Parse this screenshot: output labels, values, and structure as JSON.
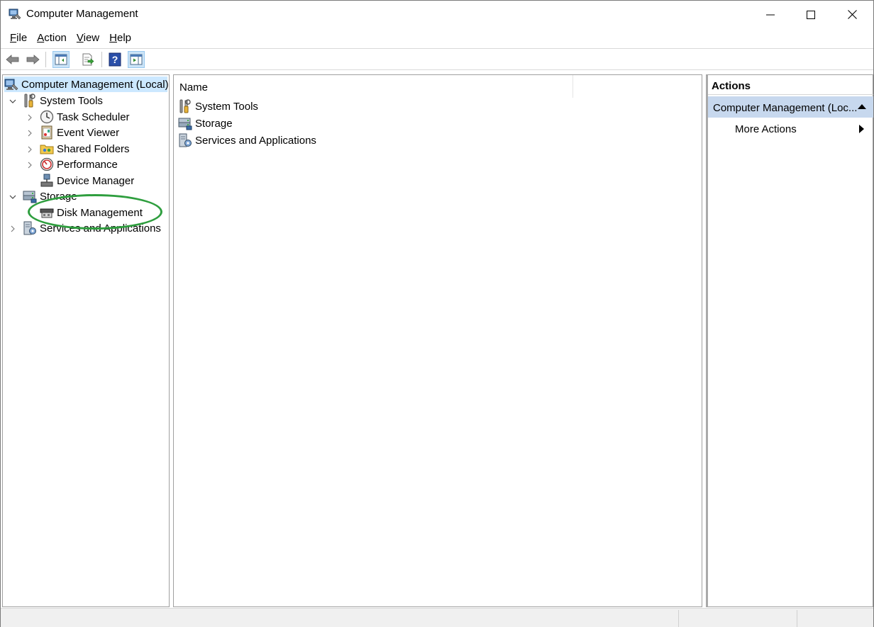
{
  "window": {
    "title": "Computer Management"
  },
  "menu": [
    {
      "label": "File",
      "key": "F",
      "rest": "ile"
    },
    {
      "label": "Action",
      "key": "A",
      "rest": "ction"
    },
    {
      "label": "View",
      "key": "V",
      "rest": "iew"
    },
    {
      "label": "Help",
      "key": "H",
      "rest": "elp"
    }
  ],
  "toolbar": {
    "buttons": [
      "back-arrow-icon",
      "forward-arrow-icon",
      "show-hide-console-tree-icon",
      "export-list-icon",
      "help-icon",
      "show-hide-action-pane-icon"
    ]
  },
  "tree": {
    "root": "Computer Management (Local)",
    "system_tools": "System Tools",
    "task_scheduler": "Task Scheduler",
    "event_viewer": "Event Viewer",
    "shared_folders": "Shared Folders",
    "performance": "Performance",
    "device_manager": "Device Manager",
    "storage": "Storage",
    "disk_management": "Disk Management",
    "services_apps": "Services and Applications"
  },
  "list": {
    "column_name": "Name",
    "items": [
      "System Tools",
      "Storage",
      "Services and Applications"
    ]
  },
  "actions": {
    "title": "Actions",
    "section": "Computer Management (Loc...",
    "more_actions": "More Actions"
  },
  "colors": {
    "selection": "#cce8ff",
    "actions_header": "#c7d8ee",
    "highlight": "#2e9e3e"
  }
}
